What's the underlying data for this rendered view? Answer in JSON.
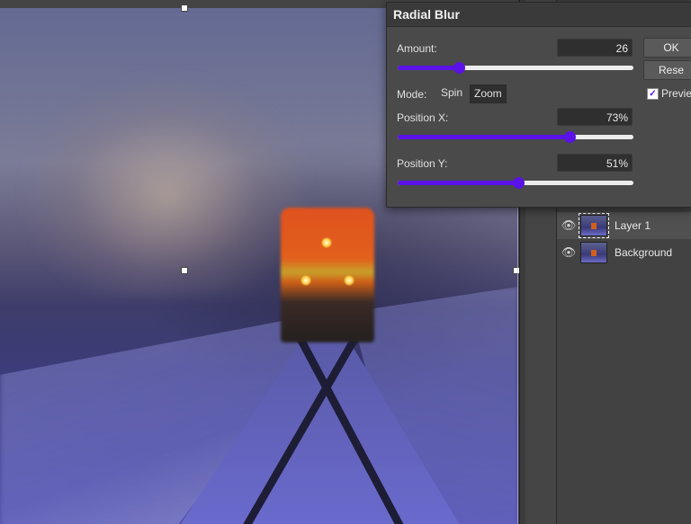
{
  "dialog": {
    "title": "Radial Blur",
    "amount": {
      "label": "Amount:",
      "value": "26",
      "fraction": 0.26
    },
    "mode": {
      "label": "Mode:",
      "options": [
        "Spin",
        "Zoom"
      ],
      "selected": "Zoom"
    },
    "position_x": {
      "label": "Position X:",
      "value": "73%",
      "fraction": 0.73
    },
    "position_y": {
      "label": "Position Y:",
      "value": "51%",
      "fraction": 0.51
    },
    "ok_label": "OK",
    "reset_label": "Rese",
    "preview_label": "Preview",
    "preview_checked": true
  },
  "layers": [
    {
      "name": "Layer 1",
      "active": true
    },
    {
      "name": "Background",
      "active": false
    }
  ],
  "colors": {
    "accent": "#5a12e6",
    "dialog_bg": "#4a4a4a",
    "panel_bg": "#3c3c3c"
  },
  "icons": {
    "visibility": "eye-icon",
    "preview_check": "check-icon"
  }
}
